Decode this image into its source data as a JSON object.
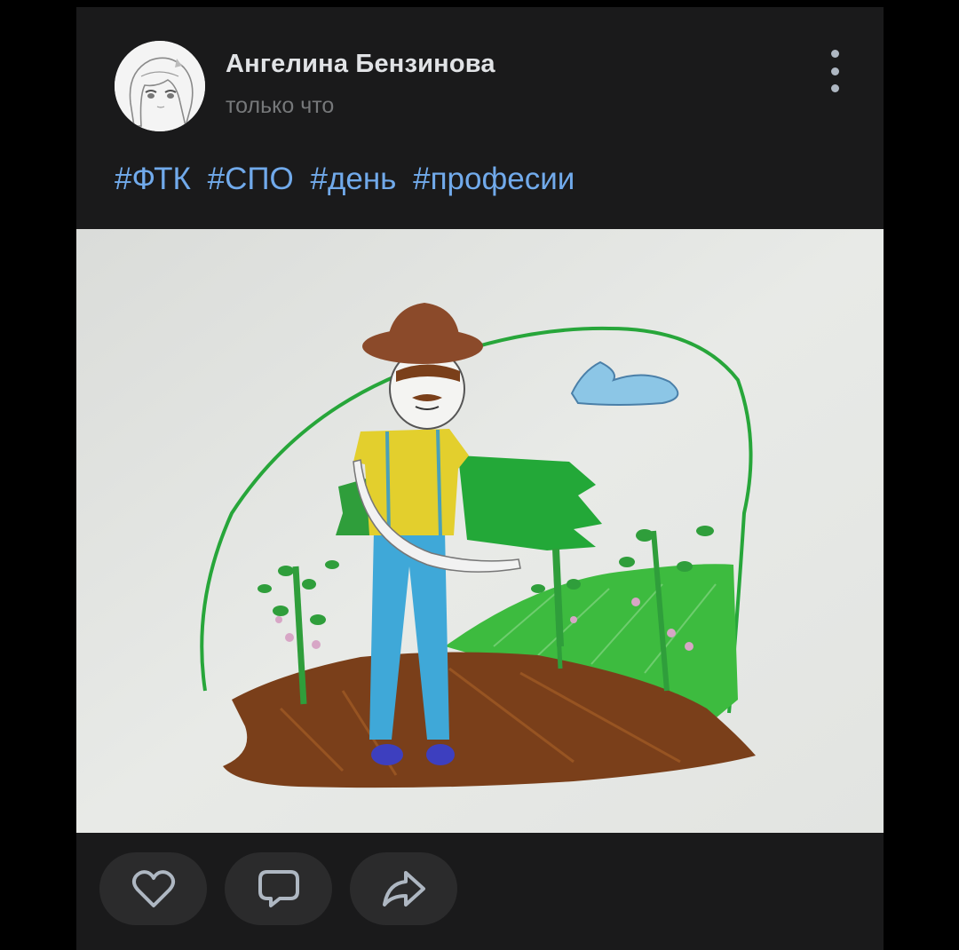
{
  "post": {
    "author": "Ангелина Бензинова",
    "time": "только что",
    "hashtags": [
      "#ФТК",
      "#СПО",
      "#день",
      "#професии"
    ],
    "avatar_icon": "anime-girl-avatar",
    "menu_icon": "more-vertical-icon",
    "image_description_icon": "drawing-photo"
  },
  "actions": {
    "like_icon": "heart-icon",
    "comment_icon": "comment-icon",
    "share_icon": "share-arrow-icon"
  },
  "colors": {
    "background": "#000000",
    "card": "#1a1a1b",
    "author_text": "#e1e3e6",
    "secondary_text": "#76787a",
    "hashtag": "#71aaeb",
    "action_button": "#2b2b2c"
  }
}
